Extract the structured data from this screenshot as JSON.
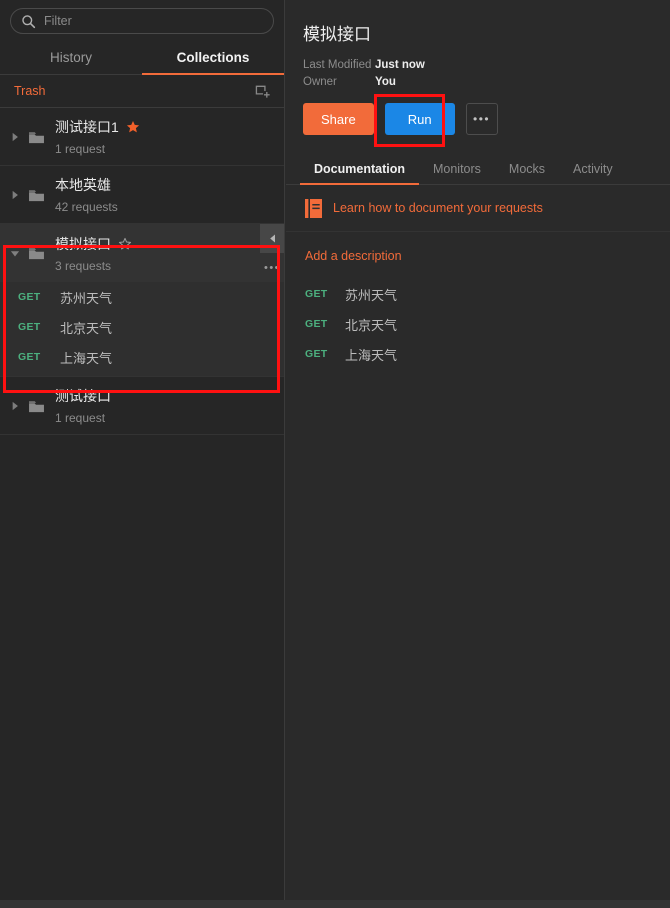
{
  "colors": {
    "accent_orange": "#f26b3a",
    "run_blue": "#1b87e6",
    "method_green": "#4cb07f",
    "highlight_red": "#ff1111",
    "sidebar_bg": "#262626",
    "main_bg": "#2a2a2a"
  },
  "sidebar": {
    "filter": {
      "placeholder": "Filter",
      "value": "",
      "icon": "search-icon"
    },
    "tabs": [
      {
        "label": "History",
        "active": false
      },
      {
        "label": "Collections",
        "active": true
      }
    ],
    "trash": {
      "label": "Trash",
      "new_collection_icon": "new-collection-icon"
    },
    "collections": [
      {
        "name": "测试接口1",
        "count": "1 request",
        "starred": true,
        "expanded": false,
        "selected": false,
        "requests": []
      },
      {
        "name": "本地英雄",
        "count": "42 requests",
        "starred": false,
        "expanded": false,
        "selected": false,
        "requests": []
      },
      {
        "name": "模拟接口",
        "count": "3 requests",
        "starred": false,
        "expanded": true,
        "selected": true,
        "collapse_icon": "caret-left-icon",
        "more_label": "•••",
        "requests": [
          {
            "method": "GET",
            "name": "苏州天气"
          },
          {
            "method": "GET",
            "name": "北京天气"
          },
          {
            "method": "GET",
            "name": "上海天气"
          }
        ]
      },
      {
        "name": "测试接口",
        "count": "1 request",
        "starred": false,
        "expanded": false,
        "selected": false,
        "requests": []
      }
    ]
  },
  "main": {
    "title": "模拟接口",
    "meta": [
      {
        "key": "Last Modified",
        "value": "Just now"
      },
      {
        "key": "Owner",
        "value": "You"
      }
    ],
    "buttons": {
      "share": "Share",
      "run": "Run",
      "more": "•••"
    },
    "tabs": [
      {
        "label": "Documentation",
        "active": true
      },
      {
        "label": "Monitors",
        "active": false
      },
      {
        "label": "Mocks",
        "active": false
      },
      {
        "label": "Activity",
        "active": false
      }
    ],
    "doc_banner": {
      "icon": "documentation-book-icon",
      "text": "Learn how to document your requests"
    },
    "add_description": "Add a description",
    "requests": [
      {
        "method": "GET",
        "name": "苏州天气"
      },
      {
        "method": "GET",
        "name": "北京天气"
      },
      {
        "method": "GET",
        "name": "上海天气"
      }
    ]
  },
  "annotations": [
    {
      "name": "collection-highlight-box"
    },
    {
      "name": "run-button-highlight-box"
    }
  ]
}
